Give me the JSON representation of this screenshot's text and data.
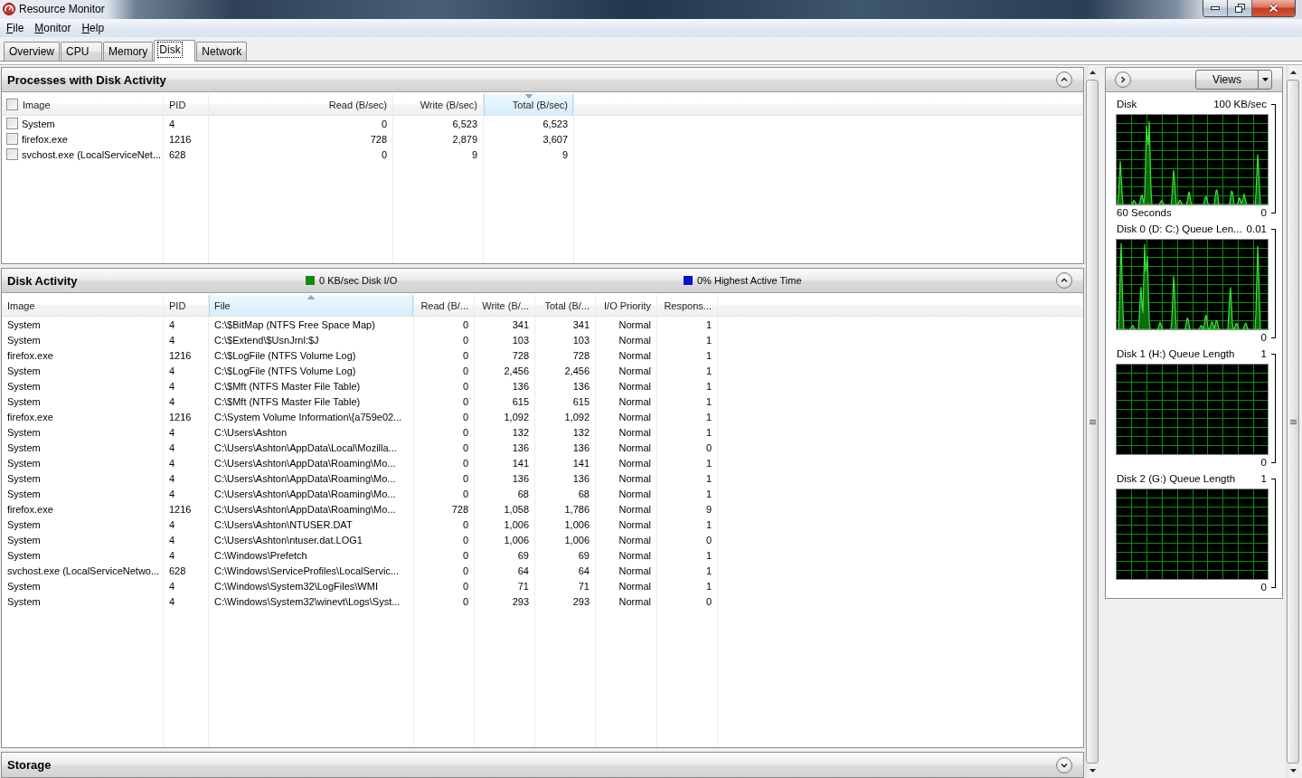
{
  "window": {
    "title": "Resource Monitor"
  },
  "menu": [
    "File",
    "Monitor",
    "Help"
  ],
  "tabs": [
    {
      "label": "Overview",
      "selected": false
    },
    {
      "label": "CPU",
      "selected": false
    },
    {
      "label": "Memory",
      "selected": false
    },
    {
      "label": "Disk",
      "selected": true
    },
    {
      "label": "Network",
      "selected": false
    }
  ],
  "panels": [
    {
      "kind": "processes",
      "title": "Processes with Disk Activity",
      "expanded": true,
      "select_all_checked": false,
      "columns": [
        {
          "label": "Image",
          "sorted": false
        },
        {
          "label": "PID",
          "sorted": false
        },
        {
          "label": "Read (B/sec)",
          "sorted": false
        },
        {
          "label": "Write (B/sec)",
          "sorted": false
        },
        {
          "label": "Total (B/sec)",
          "sorted": true,
          "descending": true
        }
      ],
      "rows": [
        {
          "checked": false,
          "cells": [
            "System",
            "4",
            "0",
            "6,523",
            "6,523"
          ]
        },
        {
          "checked": false,
          "cells": [
            "firefox.exe",
            "1216",
            "728",
            "2,879",
            "3,607"
          ]
        },
        {
          "checked": false,
          "cells": [
            "svchost.exe (LocalServiceNet...",
            "628",
            "0",
            "9",
            "9"
          ]
        }
      ]
    },
    {
      "kind": "activity",
      "title": "Disk Activity",
      "expanded": true,
      "legend": [
        {
          "label": "0 KB/sec Disk I/O",
          "color": "#128a12"
        },
        {
          "label": "0% Highest Active Time",
          "color": "#0a12c4"
        }
      ],
      "columns": [
        {
          "label": "Image",
          "sorted": false
        },
        {
          "label": "PID",
          "sorted": false
        },
        {
          "label": "File",
          "sorted": true,
          "descending": false
        },
        {
          "label": "Read (B/...",
          "sorted": false
        },
        {
          "label": "Write (B/...",
          "sorted": false
        },
        {
          "label": "Total (B/...",
          "sorted": false
        },
        {
          "label": "I/O Priority",
          "sorted": false
        },
        {
          "label": "Respons...",
          "sorted": false
        }
      ],
      "rows": [
        [
          "System",
          "4",
          "C:\\$BitMap (NTFS Free Space Map)",
          "0",
          "341",
          "341",
          "Normal",
          "1"
        ],
        [
          "System",
          "4",
          "C:\\$Extend\\$UsnJrnl:$J",
          "0",
          "103",
          "103",
          "Normal",
          "1"
        ],
        [
          "firefox.exe",
          "1216",
          "C:\\$LogFile (NTFS Volume Log)",
          "0",
          "728",
          "728",
          "Normal",
          "1"
        ],
        [
          "System",
          "4",
          "C:\\$LogFile (NTFS Volume Log)",
          "0",
          "2,456",
          "2,456",
          "Normal",
          "1"
        ],
        [
          "System",
          "4",
          "C:\\$Mft (NTFS Master File Table)",
          "0",
          "136",
          "136",
          "Normal",
          "1"
        ],
        [
          "System",
          "4",
          "C:\\$Mft (NTFS Master File Table)",
          "0",
          "615",
          "615",
          "Normal",
          "1"
        ],
        [
          "firefox.exe",
          "1216",
          "C:\\System Volume Information\\{a759e02...",
          "0",
          "1,092",
          "1,092",
          "Normal",
          "1"
        ],
        [
          "System",
          "4",
          "C:\\Users\\Ashton",
          "0",
          "132",
          "132",
          "Normal",
          "1"
        ],
        [
          "System",
          "4",
          "C:\\Users\\Ashton\\AppData\\Local\\Mozilla...",
          "0",
          "136",
          "136",
          "Normal",
          "0"
        ],
        [
          "System",
          "4",
          "C:\\Users\\Ashton\\AppData\\Roaming\\Mo...",
          "0",
          "141",
          "141",
          "Normal",
          "1"
        ],
        [
          "System",
          "4",
          "C:\\Users\\Ashton\\AppData\\Roaming\\Mo...",
          "0",
          "136",
          "136",
          "Normal",
          "1"
        ],
        [
          "System",
          "4",
          "C:\\Users\\Ashton\\AppData\\Roaming\\Mo...",
          "0",
          "68",
          "68",
          "Normal",
          "1"
        ],
        [
          "firefox.exe",
          "1216",
          "C:\\Users\\Ashton\\AppData\\Roaming\\Mo...",
          "728",
          "1,058",
          "1,786",
          "Normal",
          "9"
        ],
        [
          "System",
          "4",
          "C:\\Users\\Ashton\\NTUSER.DAT",
          "0",
          "1,006",
          "1,006",
          "Normal",
          "1"
        ],
        [
          "System",
          "4",
          "C:\\Users\\Ashton\\ntuser.dat.LOG1",
          "0",
          "1,006",
          "1,006",
          "Normal",
          "0"
        ],
        [
          "System",
          "4",
          "C:\\Windows\\Prefetch",
          "0",
          "69",
          "69",
          "Normal",
          "1"
        ],
        [
          "svchost.exe (LocalServiceNetwo...",
          "628",
          "C:\\Windows\\ServiceProfiles\\LocalServic...",
          "0",
          "64",
          "64",
          "Normal",
          "1"
        ],
        [
          "System",
          "4",
          "C:\\Windows\\System32\\LogFiles\\WMI",
          "0",
          "71",
          "71",
          "Normal",
          "1"
        ],
        [
          "System",
          "4",
          "C:\\Windows\\System32\\winevt\\Logs\\Syst...",
          "0",
          "293",
          "293",
          "Normal",
          "0"
        ]
      ]
    },
    {
      "kind": "storage",
      "title": "Storage",
      "expanded": false
    }
  ],
  "side_panel": {
    "views_label": "Views",
    "graphs": [
      {
        "title": "Disk",
        "scale_max": "100 KB/sec",
        "time_span": "60 Seconds",
        "scale_min": "0",
        "has_activity": true
      },
      {
        "title": "Disk 0 (D: C:) Queue Len...",
        "scale_max": "0.01",
        "scale_min": "0",
        "has_activity": true
      },
      {
        "title": "Disk 1 (H:) Queue Length",
        "scale_max": "1",
        "scale_min": "0",
        "has_activity": false
      },
      {
        "title": "Disk 2 (G:) Queue Length",
        "scale_max": "1",
        "scale_min": "0",
        "has_activity": false
      }
    ]
  }
}
